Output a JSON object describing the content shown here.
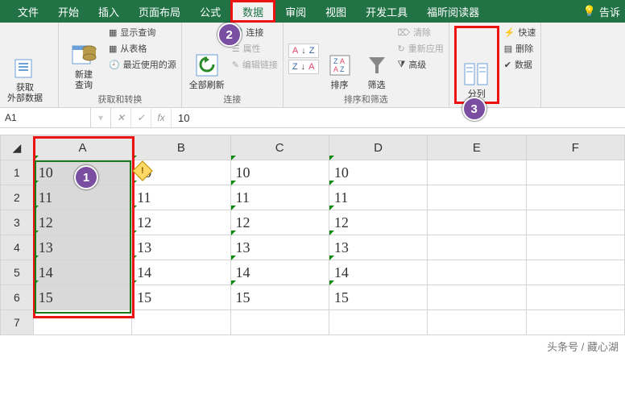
{
  "tabs": {
    "file": "文件",
    "home": "开始",
    "insert": "插入",
    "layout": "页面布局",
    "formulas": "公式",
    "data": "数据",
    "review": "审阅",
    "view": "视图",
    "dev": "开发工具",
    "foxit": "福昕阅读器",
    "tell": "告诉"
  },
  "ribbon": {
    "ext_data": "获取\n外部数据",
    "new_query": "新建\n查询",
    "show_query": "显示查询",
    "from_table": "从表格",
    "recent": "最近使用的源",
    "grp1": "获取和转换",
    "refresh": "全部刷新",
    "connections": "连接",
    "properties": "属性",
    "edit_links": "编辑链接",
    "grp2": "连接",
    "az": "A",
    "za": "Z",
    "sort": "排序",
    "filter": "筛选",
    "clear": "清除",
    "reapply": "重新应用",
    "advanced": "高级",
    "grp3": "排序和筛选",
    "ttc": "分列",
    "flash": "快速",
    "remove": "删除",
    "validate": "数据"
  },
  "namebox": "A1",
  "fx": "fx",
  "fval": "10",
  "cols": [
    "A",
    "B",
    "C",
    "D",
    "E",
    "F"
  ],
  "rows": [
    "1",
    "2",
    "3",
    "4",
    "5",
    "6",
    "7"
  ],
  "table": [
    [
      "10",
      "10",
      "10",
      "10",
      "",
      ""
    ],
    [
      "11",
      "11",
      "11",
      "11",
      "",
      ""
    ],
    [
      "12",
      "12",
      "12",
      "12",
      "",
      ""
    ],
    [
      "13",
      "13",
      "13",
      "13",
      "",
      ""
    ],
    [
      "14",
      "14",
      "14",
      "14",
      "",
      ""
    ],
    [
      "15",
      "15",
      "15",
      "15",
      "",
      ""
    ],
    [
      "",
      "",
      "",
      "",
      "",
      ""
    ]
  ],
  "marks": {
    "m1": "1",
    "m2": "2",
    "m3": "3"
  },
  "footer": "头条号 / 藏心湖"
}
